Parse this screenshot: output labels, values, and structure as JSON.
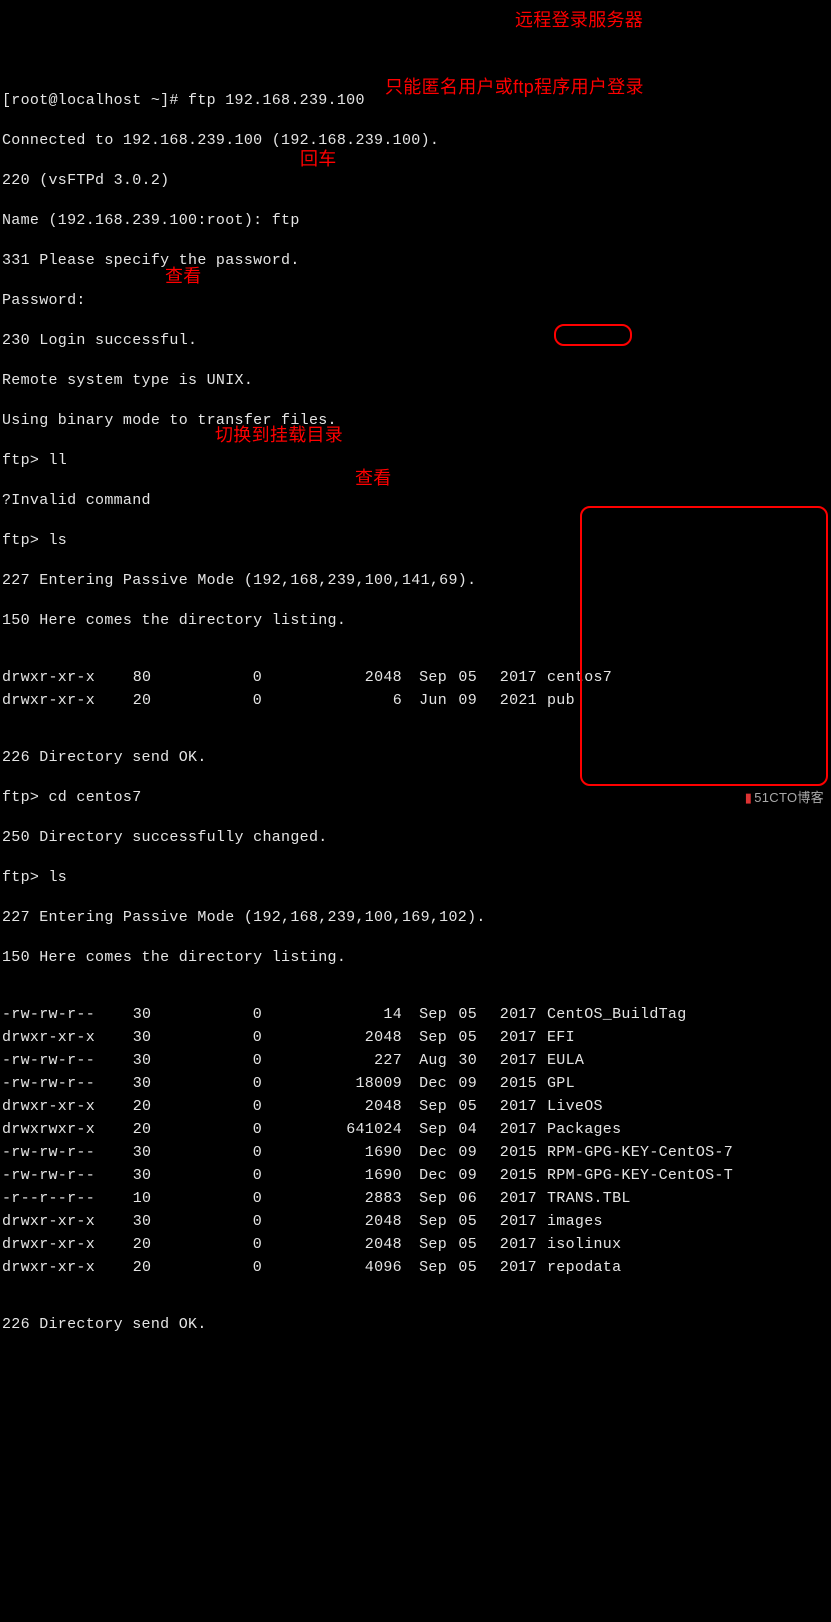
{
  "lines": {
    "l1": "[root@localhost ~]# ftp 192.168.239.100",
    "l2": "Connected to 192.168.239.100 (192.168.239.100).",
    "l3": "220 (vsFTPd 3.0.2)",
    "l4": "Name (192.168.239.100:root): ftp",
    "l5": "331 Please specify the password.",
    "l6": "Password:",
    "l7": "230 Login successful.",
    "l8": "Remote system type is UNIX.",
    "l9": "Using binary mode to transfer files.",
    "l10": "ftp> ll",
    "l11": "?Invalid command",
    "l12": "ftp> ls",
    "l13": "227 Entering Passive Mode (192,168,239,100,141,69).",
    "l14": "150 Here comes the directory listing.",
    "l17": "226 Directory send OK.",
    "l18": "ftp> cd centos7",
    "l19": "250 Directory successfully changed.",
    "l20": "ftp> ls",
    "l21": "227 Entering Passive Mode (192,168,239,100,169,102).",
    "l22": "150 Here comes the directory listing.",
    "l35": "226 Directory send OK."
  },
  "listing1": [
    {
      "perm": "drwxr-xr-x",
      "n": "8",
      "o": "0",
      "g": "0",
      "size": "2048",
      "mon": "Sep",
      "day": "05",
      "yr": "2017",
      "name": "centos7"
    },
    {
      "perm": "drwxr-xr-x",
      "n": "2",
      "o": "0",
      "g": "0",
      "size": "6",
      "mon": "Jun",
      "day": "09",
      "yr": "2021",
      "name": "pub"
    }
  ],
  "listing2": [
    {
      "perm": "-rw-rw-r--",
      "n": "3",
      "o": "0",
      "g": "0",
      "size": "14",
      "mon": "Sep",
      "day": "05",
      "yr": "2017",
      "name": "CentOS_BuildTag"
    },
    {
      "perm": "drwxr-xr-x",
      "n": "3",
      "o": "0",
      "g": "0",
      "size": "2048",
      "mon": "Sep",
      "day": "05",
      "yr": "2017",
      "name": "EFI"
    },
    {
      "perm": "-rw-rw-r--",
      "n": "3",
      "o": "0",
      "g": "0",
      "size": "227",
      "mon": "Aug",
      "day": "30",
      "yr": "2017",
      "name": "EULA"
    },
    {
      "perm": "-rw-rw-r--",
      "n": "3",
      "o": "0",
      "g": "0",
      "size": "18009",
      "mon": "Dec",
      "day": "09",
      "yr": "2015",
      "name": "GPL"
    },
    {
      "perm": "drwxr-xr-x",
      "n": "2",
      "o": "0",
      "g": "0",
      "size": "2048",
      "mon": "Sep",
      "day": "05",
      "yr": "2017",
      "name": "LiveOS"
    },
    {
      "perm": "drwxrwxr-x",
      "n": "2",
      "o": "0",
      "g": "0",
      "size": "641024",
      "mon": "Sep",
      "day": "04",
      "yr": "2017",
      "name": "Packages"
    },
    {
      "perm": "-rw-rw-r--",
      "n": "3",
      "o": "0",
      "g": "0",
      "size": "1690",
      "mon": "Dec",
      "day": "09",
      "yr": "2015",
      "name": "RPM-GPG-KEY-CentOS-7"
    },
    {
      "perm": "-rw-rw-r--",
      "n": "3",
      "o": "0",
      "g": "0",
      "size": "1690",
      "mon": "Dec",
      "day": "09",
      "yr": "2015",
      "name": "RPM-GPG-KEY-CentOS-T"
    },
    {
      "perm": "-r--r--r--",
      "n": "1",
      "o": "0",
      "g": "0",
      "size": "2883",
      "mon": "Sep",
      "day": "06",
      "yr": "2017",
      "name": "TRANS.TBL"
    },
    {
      "perm": "drwxr-xr-x",
      "n": "3",
      "o": "0",
      "g": "0",
      "size": "2048",
      "mon": "Sep",
      "day": "05",
      "yr": "2017",
      "name": "images"
    },
    {
      "perm": "drwxr-xr-x",
      "n": "2",
      "o": "0",
      "g": "0",
      "size": "2048",
      "mon": "Sep",
      "day": "05",
      "yr": "2017",
      "name": "isolinux"
    },
    {
      "perm": "drwxr-xr-x",
      "n": "2",
      "o": "0",
      "g": "0",
      "size": "4096",
      "mon": "Sep",
      "day": "05",
      "yr": "2017",
      "name": "repodata"
    }
  ],
  "annotations": {
    "a1": "远程登录服务器",
    "a2": "只能匿名用户或ftp程序用户登录",
    "a3": "回车",
    "a4": "查看",
    "a5": "切换到挂载目录",
    "a6": "查看"
  },
  "watermark": "51CTO博客"
}
